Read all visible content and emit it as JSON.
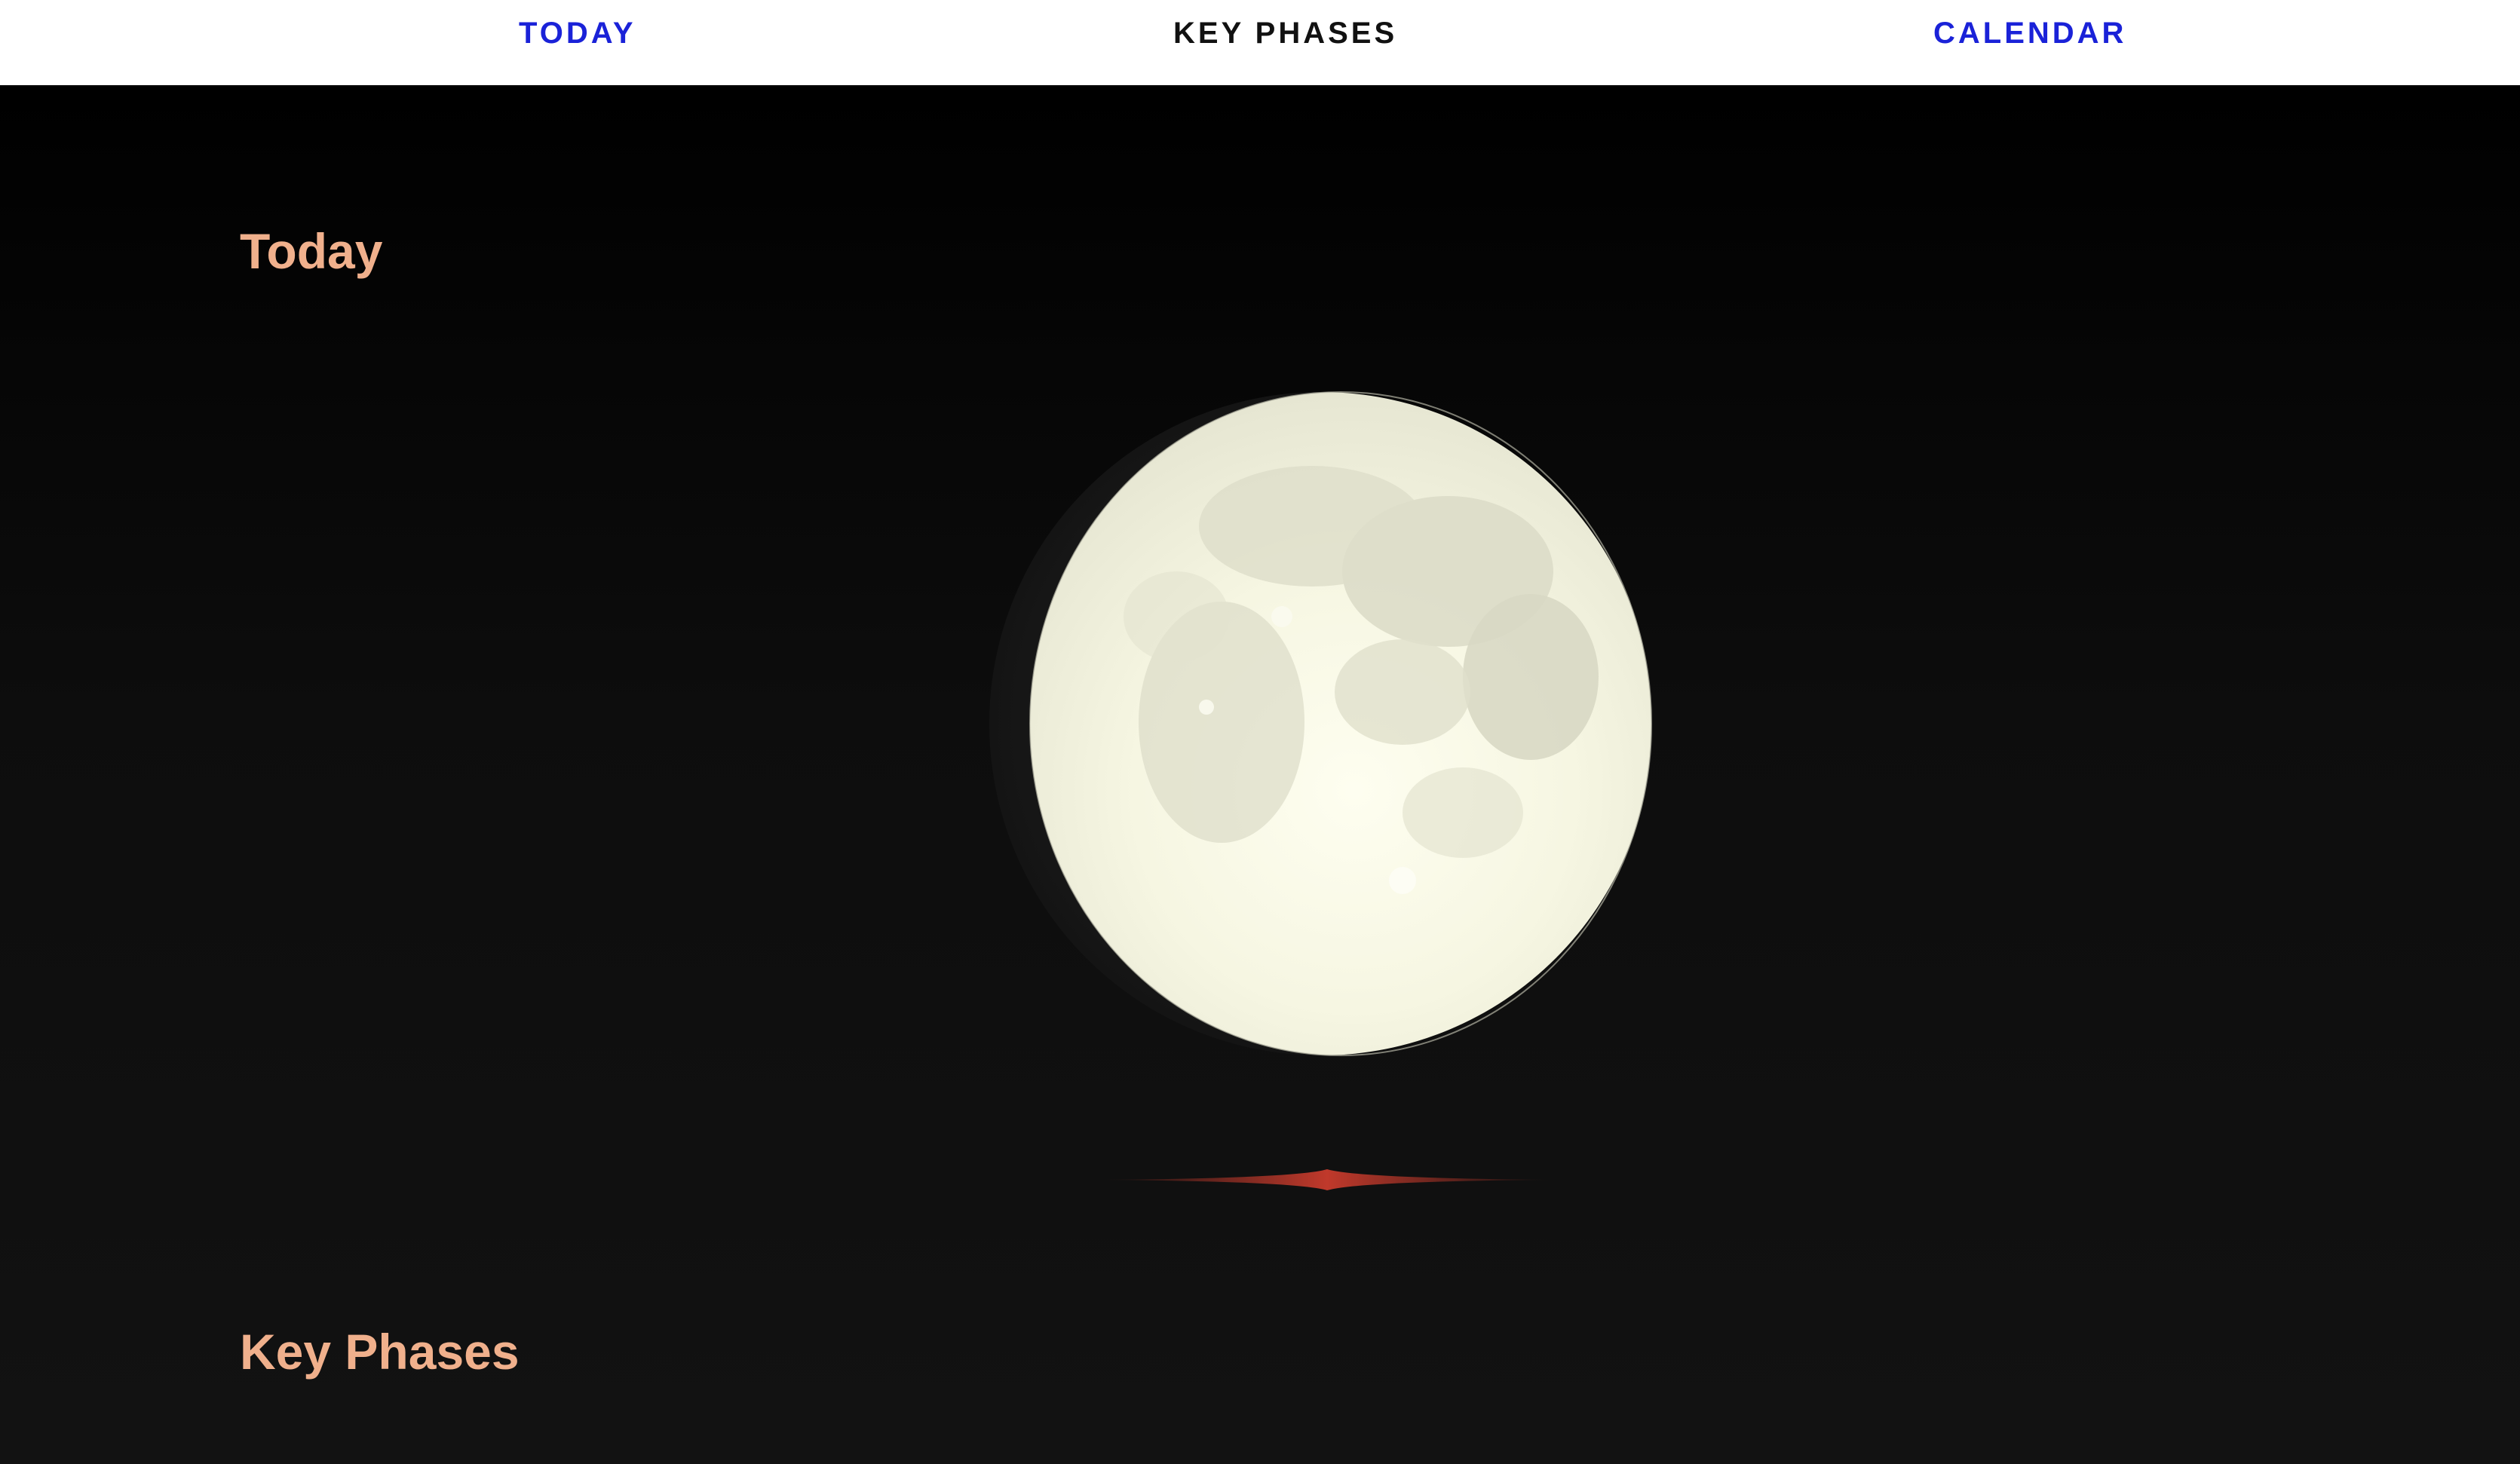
{
  "nav": {
    "items": [
      {
        "label": "TODAY"
      },
      {
        "label": "KEY PHASES"
      },
      {
        "label": "CALENDAR"
      }
    ],
    "active": "KEY PHASES",
    "link_color": "#1a22d8",
    "active_color": "#111111"
  },
  "sections": {
    "today": {
      "heading": "Today"
    },
    "key_phases": {
      "heading": "Key Phases"
    }
  },
  "moon": {
    "phase_visual": "waxing-gibbous",
    "illumination": 0.95,
    "lit_color": "#fbfbe6",
    "shadow_color": "#1a1a1a"
  },
  "colors": {
    "heading": "#f0b08c",
    "background": "#111111",
    "divider_accent": "#c0392b",
    "nav_background": "#ffffff"
  },
  "icons": {
    "moon": "moon-phase-image",
    "divider": "diamond-divider-icon"
  }
}
